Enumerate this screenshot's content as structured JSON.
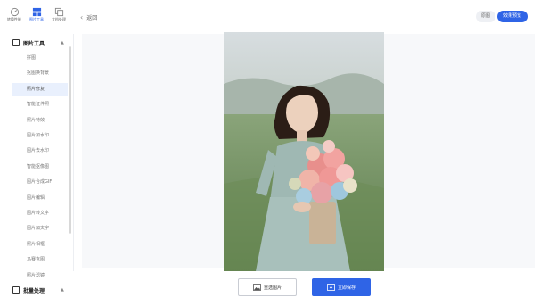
{
  "sidebar": {
    "top_icons": [
      {
        "label": "转换性能",
        "icon": "gauge-icon"
      },
      {
        "label": "图片工具",
        "icon": "grid-icon"
      },
      {
        "label": "文档处理",
        "icon": "layers-icon"
      }
    ],
    "section_image_tools": "图片工具",
    "items": [
      {
        "label": "拼图"
      },
      {
        "label": "抠图换背景"
      },
      {
        "label": "照片修复"
      },
      {
        "label": "智能证件照"
      },
      {
        "label": "照片特效"
      },
      {
        "label": "图片加水印"
      },
      {
        "label": "图片去水印"
      },
      {
        "label": "智能抠像图"
      },
      {
        "label": "图片合成GIF"
      },
      {
        "label": "图片编辑"
      },
      {
        "label": "图片转文字"
      },
      {
        "label": "图片加文字"
      },
      {
        "label": "照片相框"
      },
      {
        "label": "马赛克图"
      },
      {
        "label": "照片滤镜"
      }
    ],
    "active_item": "照片修复",
    "section_batch": "批量处理"
  },
  "topbar": {
    "back_label": "返回",
    "original_label": "原图",
    "effect_label": "效果预览"
  },
  "actions": {
    "reselect_label": "重选图片",
    "save_label": "立即保存"
  },
  "colors": {
    "accent": "#2f64e6",
    "active_bg": "#e9f0fd"
  }
}
